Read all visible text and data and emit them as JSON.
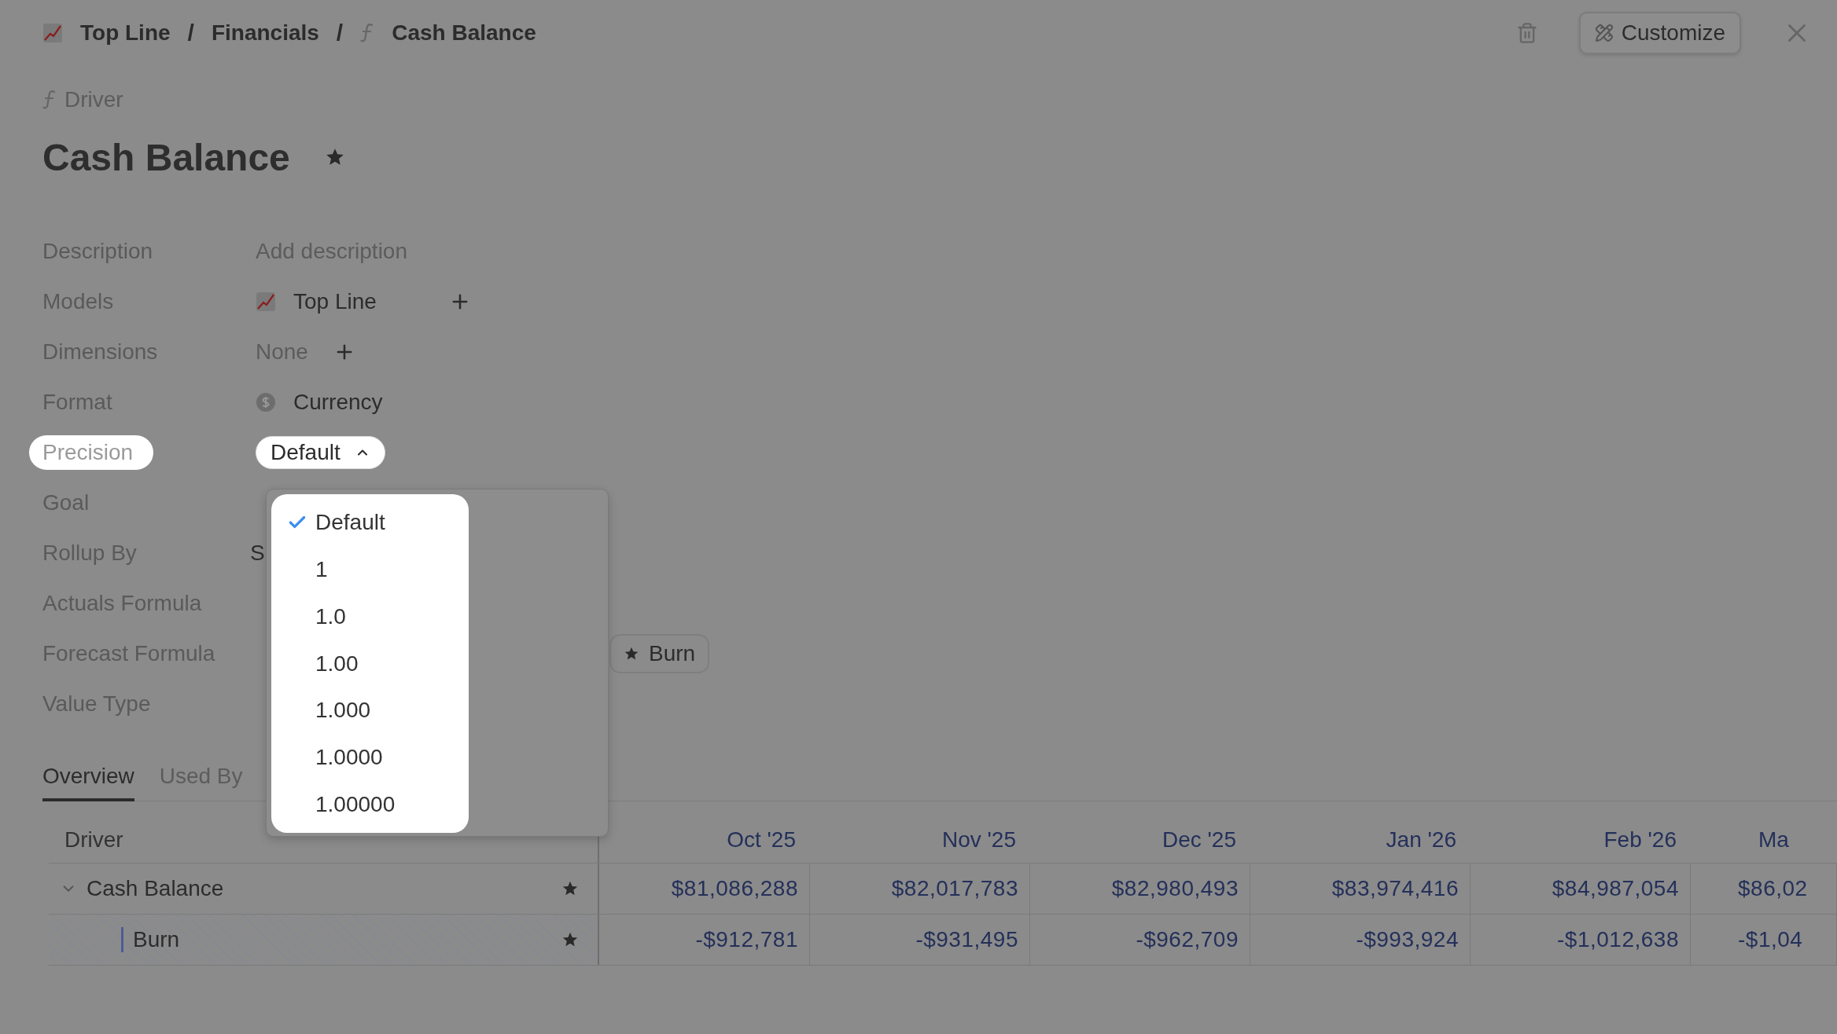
{
  "breadcrumb": [
    {
      "label": "Top Line",
      "kind": "model"
    },
    {
      "label": "Financials",
      "kind": "plain"
    },
    {
      "label": "Cash Balance",
      "kind": "driver"
    }
  ],
  "breadcrumb_separator": "/",
  "customize_button": "Customize",
  "type_label": "Driver",
  "title": "Cash Balance",
  "starred": true,
  "properties": [
    {
      "label": "Description",
      "kind": "placeholder",
      "value": "Add description",
      "highlighted": false
    },
    {
      "label": "Models",
      "kind": "model",
      "value": "Top Line",
      "addable": true,
      "highlighted": false
    },
    {
      "label": "Dimensions",
      "kind": "muted",
      "value": "None",
      "addable": true,
      "highlighted": false
    },
    {
      "label": "Format",
      "kind": "currency",
      "value": "Currency",
      "highlighted": false
    },
    {
      "label": "Precision",
      "kind": "select",
      "value": "Default",
      "highlighted": true
    },
    {
      "label": "Goal",
      "kind": "empty",
      "highlighted": false
    },
    {
      "label": "Rollup By",
      "kind": "plain",
      "value": "S",
      "highlighted": false
    },
    {
      "label": "Actuals Formula",
      "kind": "empty",
      "highlighted": false
    },
    {
      "label": "Forecast Formula",
      "kind": "chip",
      "value": "Burn",
      "highlighted": false
    },
    {
      "label": "Value Type",
      "kind": "empty",
      "highlighted": false
    }
  ],
  "precision_menu": {
    "options": [
      {
        "label": "Default",
        "selected": true
      },
      {
        "label": "1",
        "selected": false
      },
      {
        "label": "1.0",
        "selected": false
      },
      {
        "label": "1.00",
        "selected": false
      },
      {
        "label": "1.000",
        "selected": false
      },
      {
        "label": "1.0000",
        "selected": false
      },
      {
        "label": "1.00000",
        "selected": false
      }
    ]
  },
  "tabs": [
    {
      "label": "Overview",
      "selected": true
    },
    {
      "label": "Used By",
      "selected": false
    }
  ],
  "table": {
    "columns": [
      "Driver",
      "Oct '25",
      "Nov '25",
      "Dec '25",
      "Jan '26",
      "Feb '26",
      "Ma"
    ],
    "rows": [
      {
        "name": "Cash Balance",
        "expanded": true,
        "starred": true,
        "values": [
          "$81,086,288",
          "$82,017,783",
          "$82,980,493",
          "$83,974,416",
          "$84,987,054",
          "$86,02"
        ],
        "children": [
          {
            "name": "Burn",
            "starred": true,
            "values": [
              "-$912,781",
              "-$931,495",
              "-$962,709",
              "-$993,924",
              "-$1,012,638",
              "-$1,04"
            ]
          }
        ]
      }
    ]
  }
}
